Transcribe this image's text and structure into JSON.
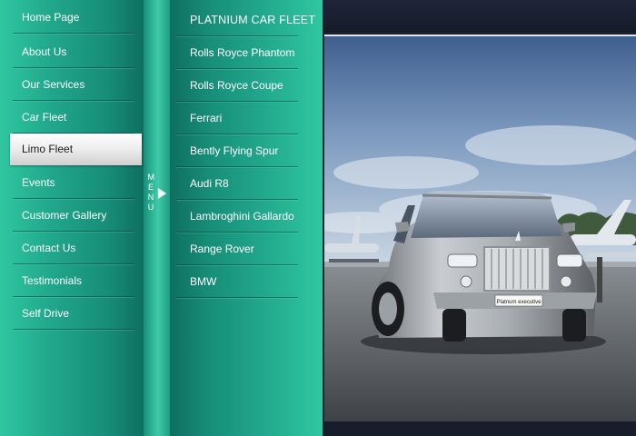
{
  "nav": {
    "items": [
      {
        "label": "Home Page",
        "active": false
      },
      {
        "label": "About Us",
        "active": false
      },
      {
        "label": "Our Services",
        "active": false
      },
      {
        "label": "Car Fleet",
        "active": false
      },
      {
        "label": "Limo Fleet",
        "active": true
      },
      {
        "label": "Events",
        "active": false
      },
      {
        "label": "Customer Gallery",
        "active": false
      },
      {
        "label": "Contact Us",
        "active": false
      },
      {
        "label": "Testimonials",
        "active": false
      },
      {
        "label": "Self Drive",
        "active": false
      }
    ]
  },
  "menu_toggle": {
    "label": "MENU",
    "icon": "triangle-right-icon"
  },
  "submenu": {
    "heading": "PLATNIUM CAR FLEET",
    "items": [
      "Rolls Royce Phantom",
      "Rolls Royce Coupe",
      "Ferrari",
      "Bently Flying Spur",
      "Audi R8",
      "Lambroghini Gallardo",
      "Range Rover",
      "BMW"
    ]
  },
  "photo": {
    "plate_text": "Platnum executive"
  },
  "colors": {
    "accent_teal": "#21a78c",
    "panel_dark": "#1c2233",
    "active_item": "#ececec"
  }
}
